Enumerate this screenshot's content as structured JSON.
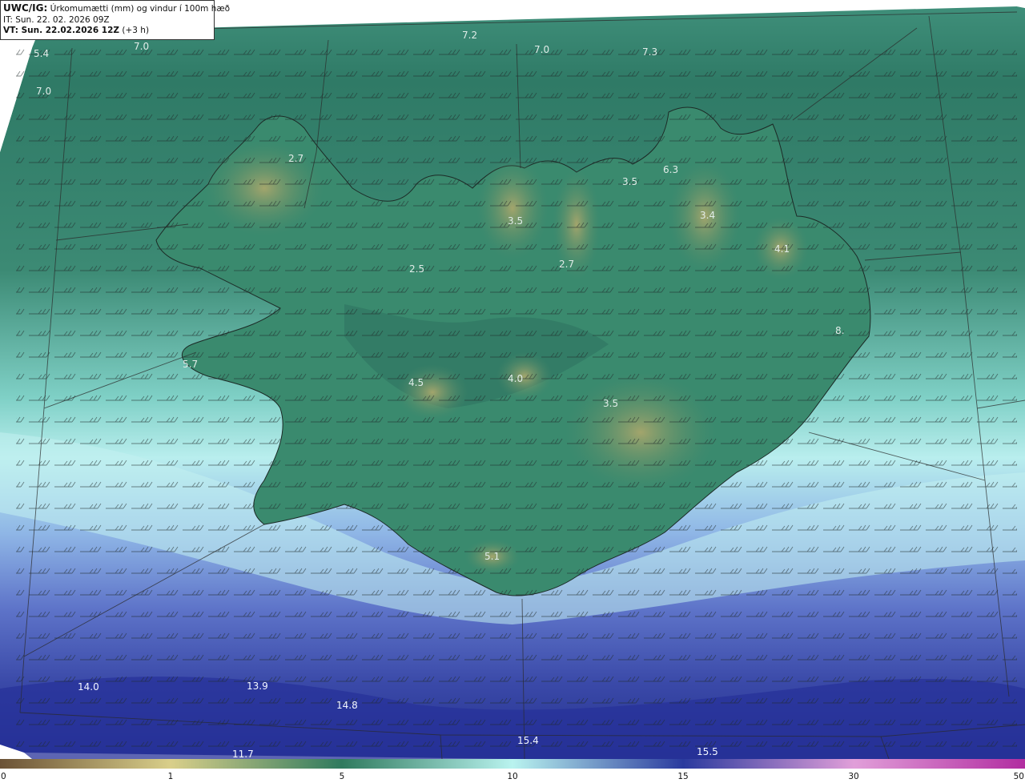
{
  "header": {
    "line1_tag": "UWC/IG:",
    "line1_text": "Úrkomumætti (mm) og vindur í 100m hæð",
    "line2_text": "IT: Sun. 22. 02. 2026 09Z",
    "line3_tag": "VT: Sun. 22.02.2026 12Z",
    "line3_text": "(+3 h)"
  },
  "value_labels": [
    {
      "text": "7.2"
    },
    {
      "text": "7.0"
    },
    {
      "text": "7.0"
    },
    {
      "text": "7.3"
    },
    {
      "text": "5.4"
    },
    {
      "text": "7.0"
    },
    {
      "text": "2.7"
    },
    {
      "text": "6.3"
    },
    {
      "text": "3.5"
    },
    {
      "text": "3.5"
    },
    {
      "text": "3.4"
    },
    {
      "text": "4.1"
    },
    {
      "text": "2.7"
    },
    {
      "text": "2.5"
    },
    {
      "text": "5.7"
    },
    {
      "text": "4.5"
    },
    {
      "text": "4.0"
    },
    {
      "text": "3.5"
    },
    {
      "text": "5.1"
    },
    {
      "text": "14.0"
    },
    {
      "text": "13.9"
    },
    {
      "text": "14.8"
    },
    {
      "text": "15.4"
    },
    {
      "text": "15.5"
    },
    {
      "text": "11.7"
    },
    {
      "text": "8."
    }
  ],
  "legend": {
    "ticks": [
      "0",
      "1",
      "5",
      "10",
      "15",
      "30",
      "50"
    ],
    "colors": [
      "#6b5236",
      "#d9cf8a",
      "#2f7a5e",
      "#b9f3ef",
      "#2a3a9e",
      "#e19fd9",
      "#b12ca0"
    ]
  },
  "colors": {
    "land_dark": "#2f6e5a",
    "land_mid": "#3d8a6e",
    "highland": "#8a9a63",
    "sea_north": "#2f7a66",
    "sea_light": "#bfeff0",
    "sea_blue": "#5a6fc8",
    "sea_deep": "#1f2a8e"
  }
}
